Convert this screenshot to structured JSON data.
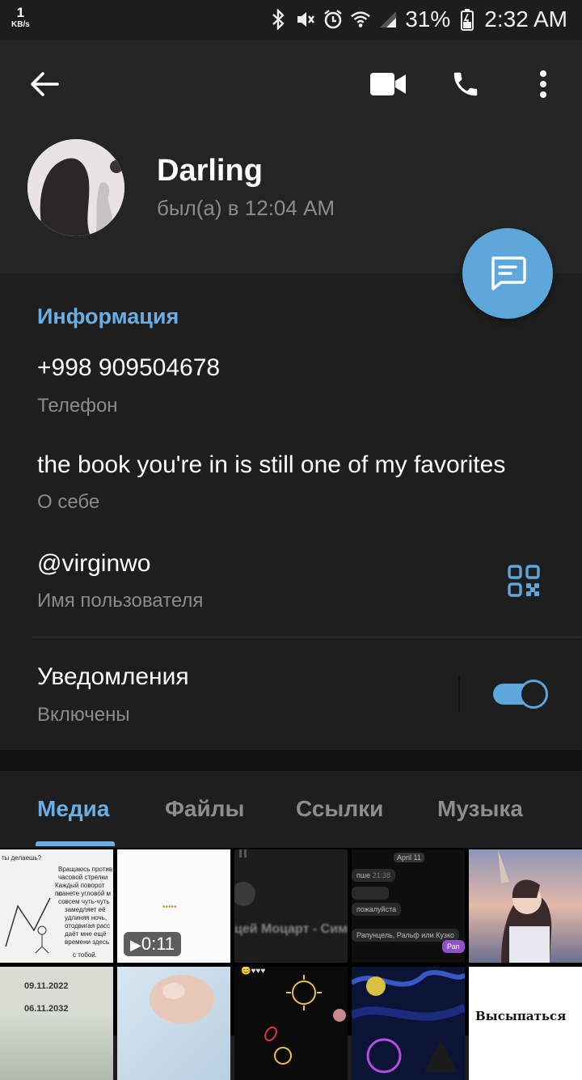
{
  "status": {
    "speed_value": "1",
    "speed_unit": "KB/s",
    "battery": "31%",
    "time": "2:32 AM"
  },
  "contact": {
    "name": "Darling",
    "last_seen": "был(а) в 12:04 AM"
  },
  "info": {
    "title": "Информация",
    "phone": "+998 909504678",
    "phone_label": "Телефон",
    "bio": "the book you're in is still one of my favorites",
    "bio_label": "О себе",
    "username": "@virginwo",
    "username_label": "Имя пользователя",
    "notifications": "Уведомления",
    "notifications_state": "Включены",
    "notifications_on": true
  },
  "tabs": [
    {
      "label": "Медиа",
      "active": true
    },
    {
      "label": "Файлы",
      "active": false
    },
    {
      "label": "Ссылки",
      "active": false
    },
    {
      "label": "Музыка",
      "active": false
    }
  ],
  "media": {
    "row1": [
      {
        "kind": "image",
        "text_lines": [
          "ты делаешь?",
          "Вращаюсь против",
          "часовой стрелки",
          "Каждый поворот по",
          "планете угловой м",
          "совсем чуть-чуть",
          "замедляет её",
          "удлиняя ночь,",
          "отодвигая расс",
          "даёт мне ещё",
          "времени здесь",
          "с тобой."
        ]
      },
      {
        "kind": "video",
        "duration": "0:11",
        "dots": "•••••"
      },
      {
        "kind": "image",
        "caption": "цей Моцарт - Симф"
      },
      {
        "kind": "image",
        "lines": [
          "April 11",
          "пше",
          "21:38",
          "пожалуйста",
          "Рапунцель, Ральф или Кузко",
          "Рап"
        ]
      },
      {
        "kind": "image"
      }
    ],
    "row2": [
      {
        "kind": "image",
        "lines": [
          "09.11.2022",
          "06.11.2032"
        ]
      },
      {
        "kind": "image"
      },
      {
        "kind": "image",
        "lines": [
          "😊♥♥♥"
        ]
      },
      {
        "kind": "image"
      },
      {
        "kind": "image",
        "caption": "Высыпаться"
      }
    ]
  }
}
